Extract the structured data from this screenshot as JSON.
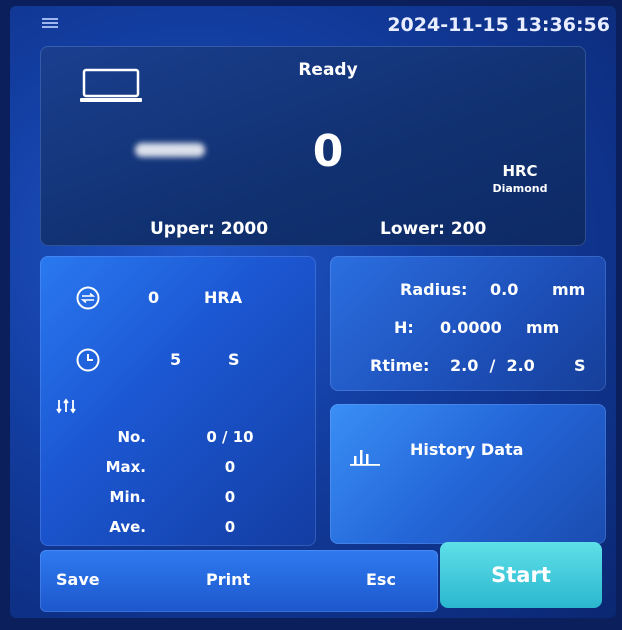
{
  "header": {
    "datetime": "2024-11-15 13:36:56"
  },
  "display": {
    "status": "Ready",
    "reading": "0",
    "scale": "HRC",
    "indenter": "Diamond",
    "upper_label": "Upper: 2000",
    "lower_label": "Lower: 200"
  },
  "conversion": {
    "value": "0",
    "unit": "HRA"
  },
  "dwell": {
    "value": "5",
    "unit": "S"
  },
  "stats": {
    "rows": [
      {
        "label": "No.",
        "value": "0 / 10"
      },
      {
        "label": "Max.",
        "value": "0"
      },
      {
        "label": "Min.",
        "value": "0"
      },
      {
        "label": "Ave.",
        "value": "0"
      }
    ]
  },
  "measure": {
    "radius_label": "Radius:",
    "radius_value": "0.0",
    "radius_unit": "mm",
    "h_label": "H:",
    "h_value": "0.0000",
    "h_unit": "mm",
    "rtime_label": "Rtime:",
    "rtime_value": "2.0  /  2.0",
    "rtime_unit": "S"
  },
  "history": {
    "label": "History Data"
  },
  "toolbar": {
    "save": "Save",
    "print": "Print",
    "esc": "Esc",
    "start": "Start"
  },
  "colors": {
    "start_button": "#3cc6d8",
    "panel_blue": "#1c58d4",
    "screen_bg": "#123c9e"
  },
  "icons": [
    "menu-icon",
    "monitor-icon",
    "conversion-icon",
    "clock-icon",
    "sort-icon",
    "history-chart-icon"
  ]
}
